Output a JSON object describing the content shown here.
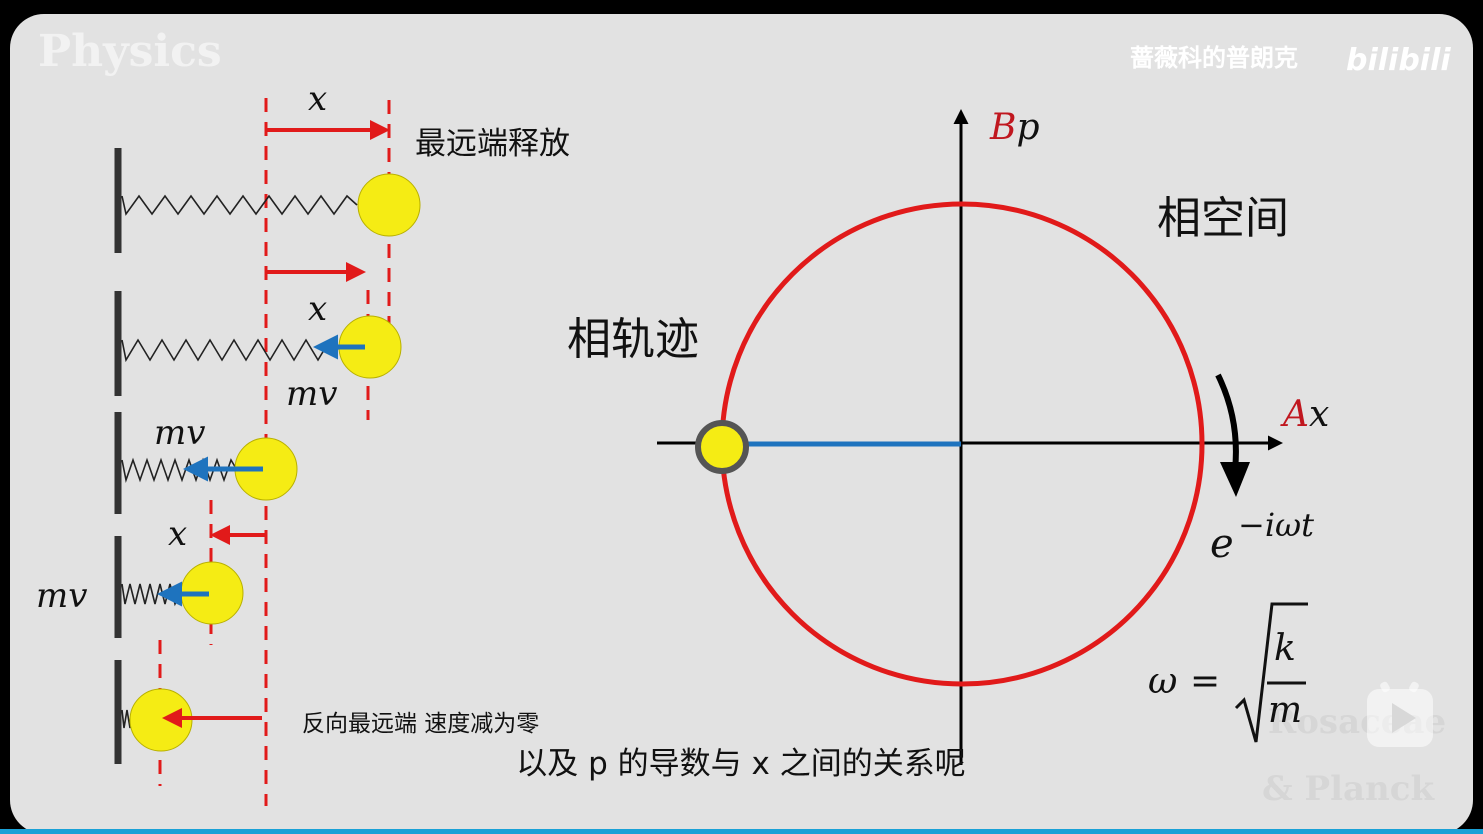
{
  "watermark": {
    "corner": "Physics",
    "channel": "蔷薇科的普朗克",
    "brand": "bilibili",
    "lower_right_1": "Rosaceae",
    "lower_right_2": "&  Planck"
  },
  "left": {
    "x": "x",
    "mv": "mv",
    "farthest_release": "最远端释放",
    "reverse_farthest": "反向最远端 速度减为零"
  },
  "right": {
    "axis_y": {
      "coef": "B",
      "var": "p"
    },
    "axis_x": {
      "coef": "A",
      "var": "x"
    },
    "phase_space": "相空间",
    "phase_trajectory": "相轨迹",
    "rotation": {
      "base": "e",
      "exp": "−iωt"
    },
    "omega": {
      "lhs": "ω",
      "eq": "=",
      "num": "k",
      "den": "m"
    }
  },
  "subtitle": "以及 p 的导数与 x 之间的关系呢",
  "colors": {
    "red": "#e11a1a",
    "blue": "#1e73be",
    "ball": "#f5ec14",
    "bg": "#e2e2e2"
  }
}
